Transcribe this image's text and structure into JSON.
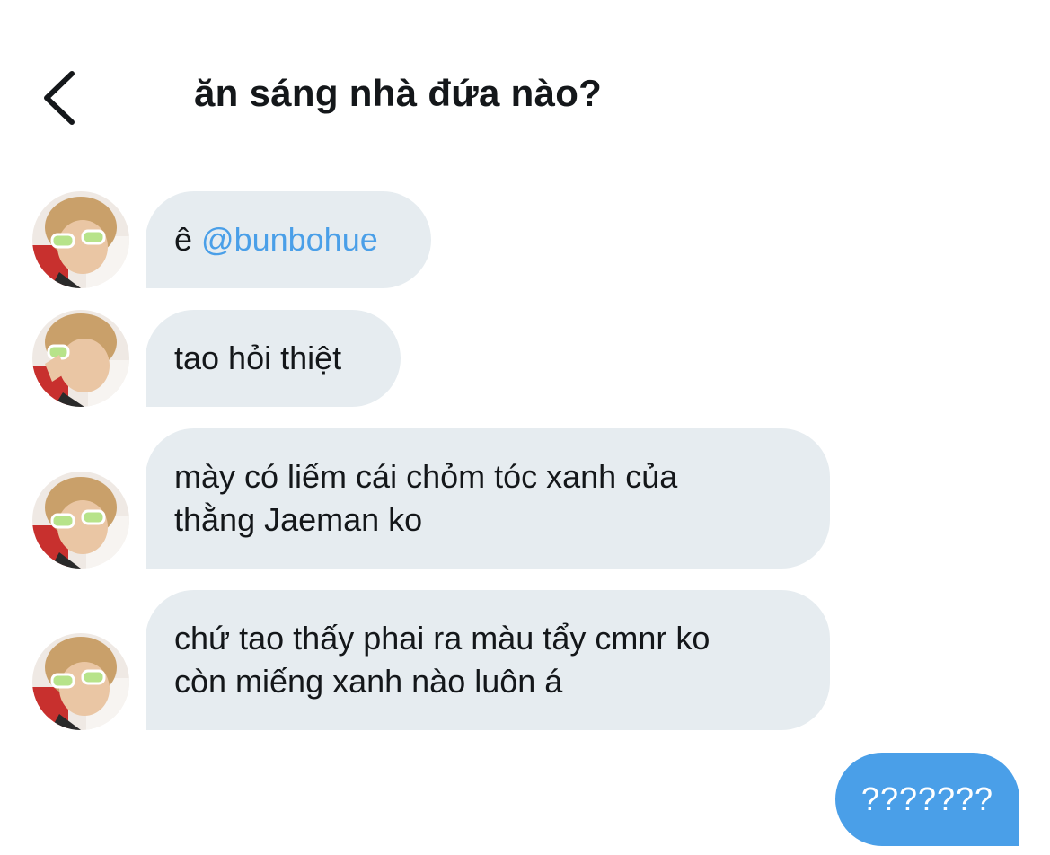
{
  "header": {
    "back_icon": "chevron-left-icon",
    "title": "ăn sáng nhà đứa nào?"
  },
  "messages": [
    {
      "prefix": "ê ",
      "mention": "@bunbohue"
    },
    {
      "text": "tao hỏi thiệt"
    },
    {
      "line1": "mày có liếm cái chỏm tóc xanh của",
      "line2": "thằng Jaeman ko"
    },
    {
      "line1": "chứ tao thấy phai ra màu tẩy cmnr ko",
      "line2": "còn miếng xanh nào luôn á"
    }
  ],
  "sent": {
    "text": "???????"
  },
  "colors": {
    "incoming_bubble": "#e6ecf0",
    "outgoing_bubble": "#4a9fe8",
    "mention": "#4a9fe8",
    "text": "#14171a"
  }
}
